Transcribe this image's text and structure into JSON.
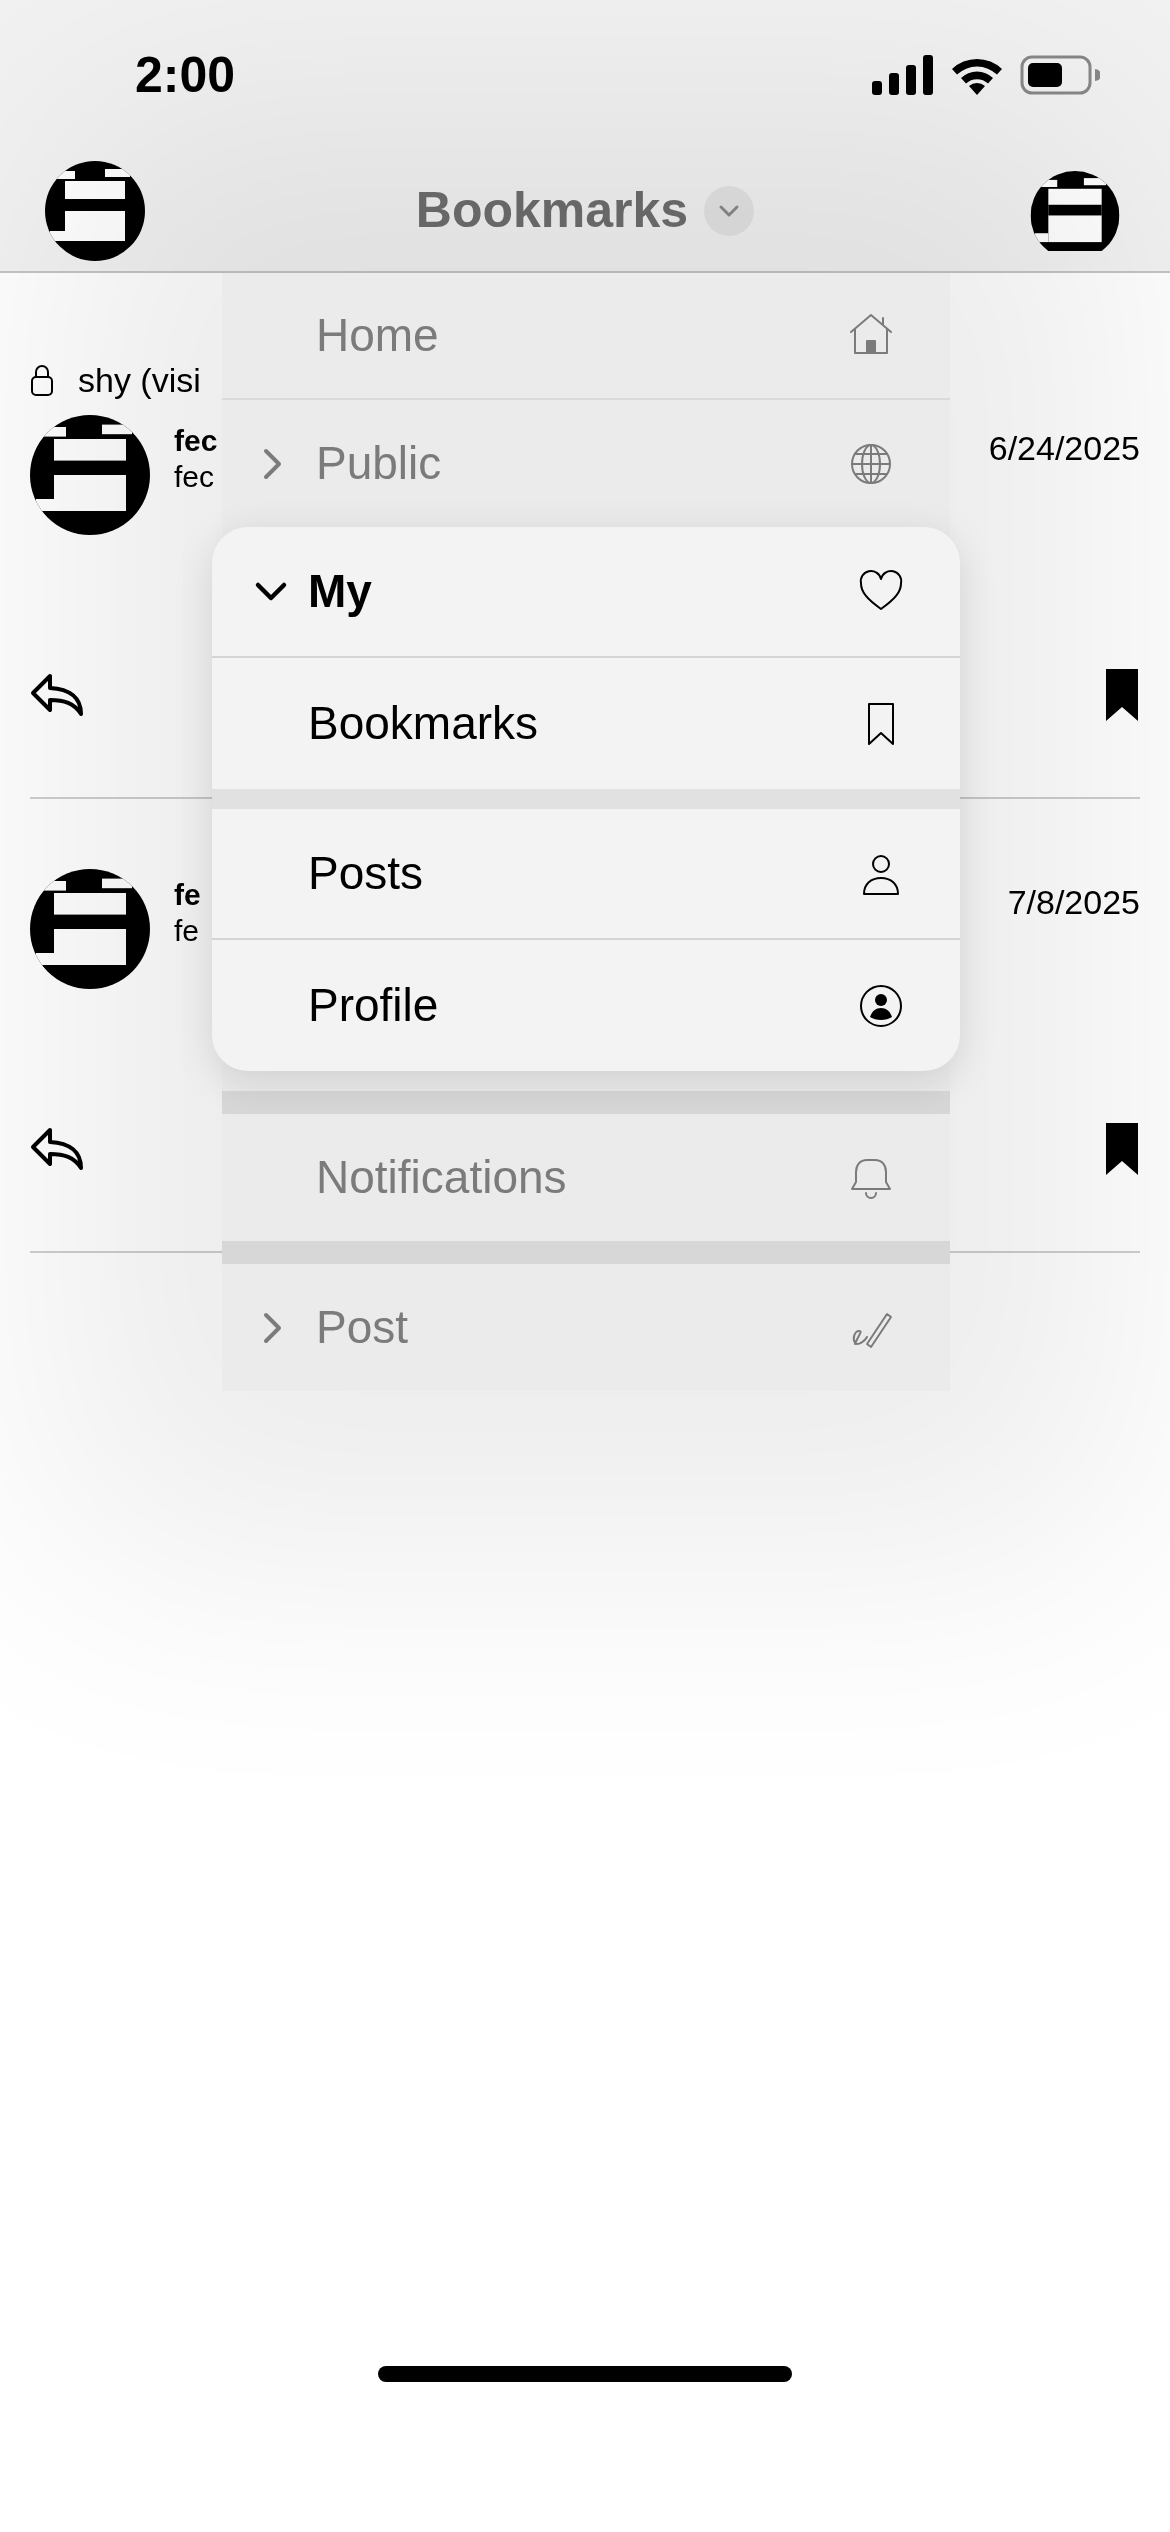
{
  "status_bar": {
    "time": "2:00"
  },
  "header": {
    "title": "Bookmarks"
  },
  "visibility": {
    "label": "shy (visi"
  },
  "posts": [
    {
      "name": "fec",
      "handle": "fec",
      "date": "6/24/2025",
      "bookmarked": true
    },
    {
      "name": "fe",
      "handle": "fe",
      "date": "7/8/2025",
      "bookmarked": true
    }
  ],
  "menu": {
    "items": [
      {
        "kind": "item",
        "label": "Home"
      },
      {
        "kind": "group",
        "label": "Public",
        "expanded": false
      },
      {
        "kind": "group",
        "label": "My",
        "expanded": true,
        "children": [
          {
            "label": "Bookmarks"
          },
          {
            "label": "Posts"
          },
          {
            "label": "Profile"
          }
        ]
      },
      {
        "kind": "item",
        "label": "Notifications"
      },
      {
        "kind": "group",
        "label": "Post",
        "expanded": false
      }
    ]
  }
}
